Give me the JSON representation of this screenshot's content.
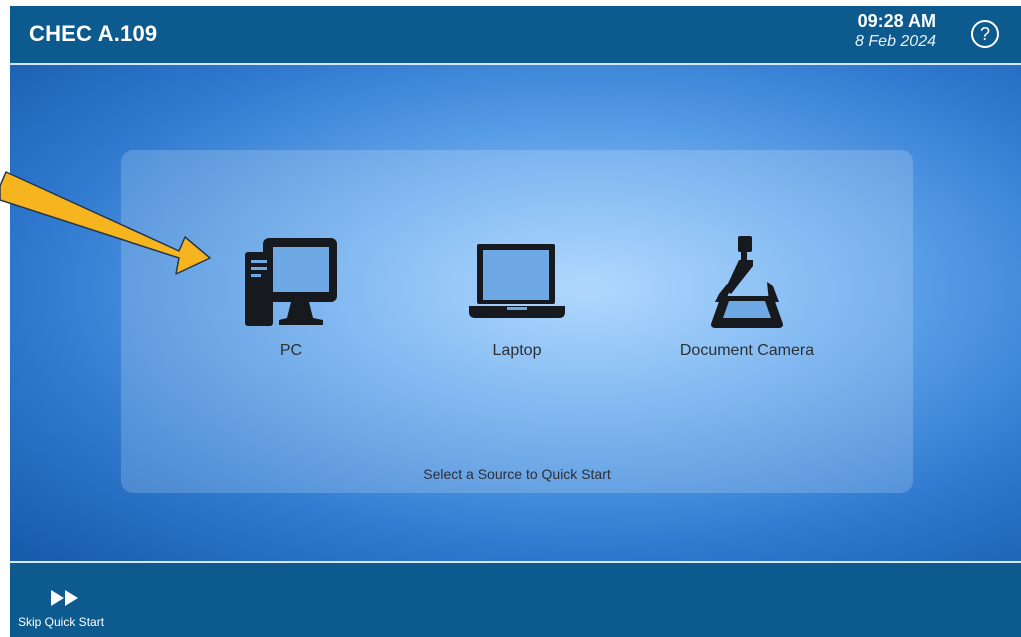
{
  "header": {
    "room": "CHEC A.109",
    "time": "09:28 AM",
    "date": "8 Feb 2024",
    "help_symbol": "?"
  },
  "sources": [
    {
      "label": "PC",
      "icon": "desktop-pc-icon"
    },
    {
      "label": "Laptop",
      "icon": "laptop-icon"
    },
    {
      "label": "Document Camera",
      "icon": "document-camera-icon"
    }
  ],
  "hint": "Select a Source to Quick Start",
  "footer": {
    "skip_label": "Skip Quick Start",
    "skip_icon": "fast-forward-icon"
  },
  "colors": {
    "bar": "#0d5a8f",
    "annotation_arrow": "#f6b51f",
    "icon": "#16191d"
  }
}
